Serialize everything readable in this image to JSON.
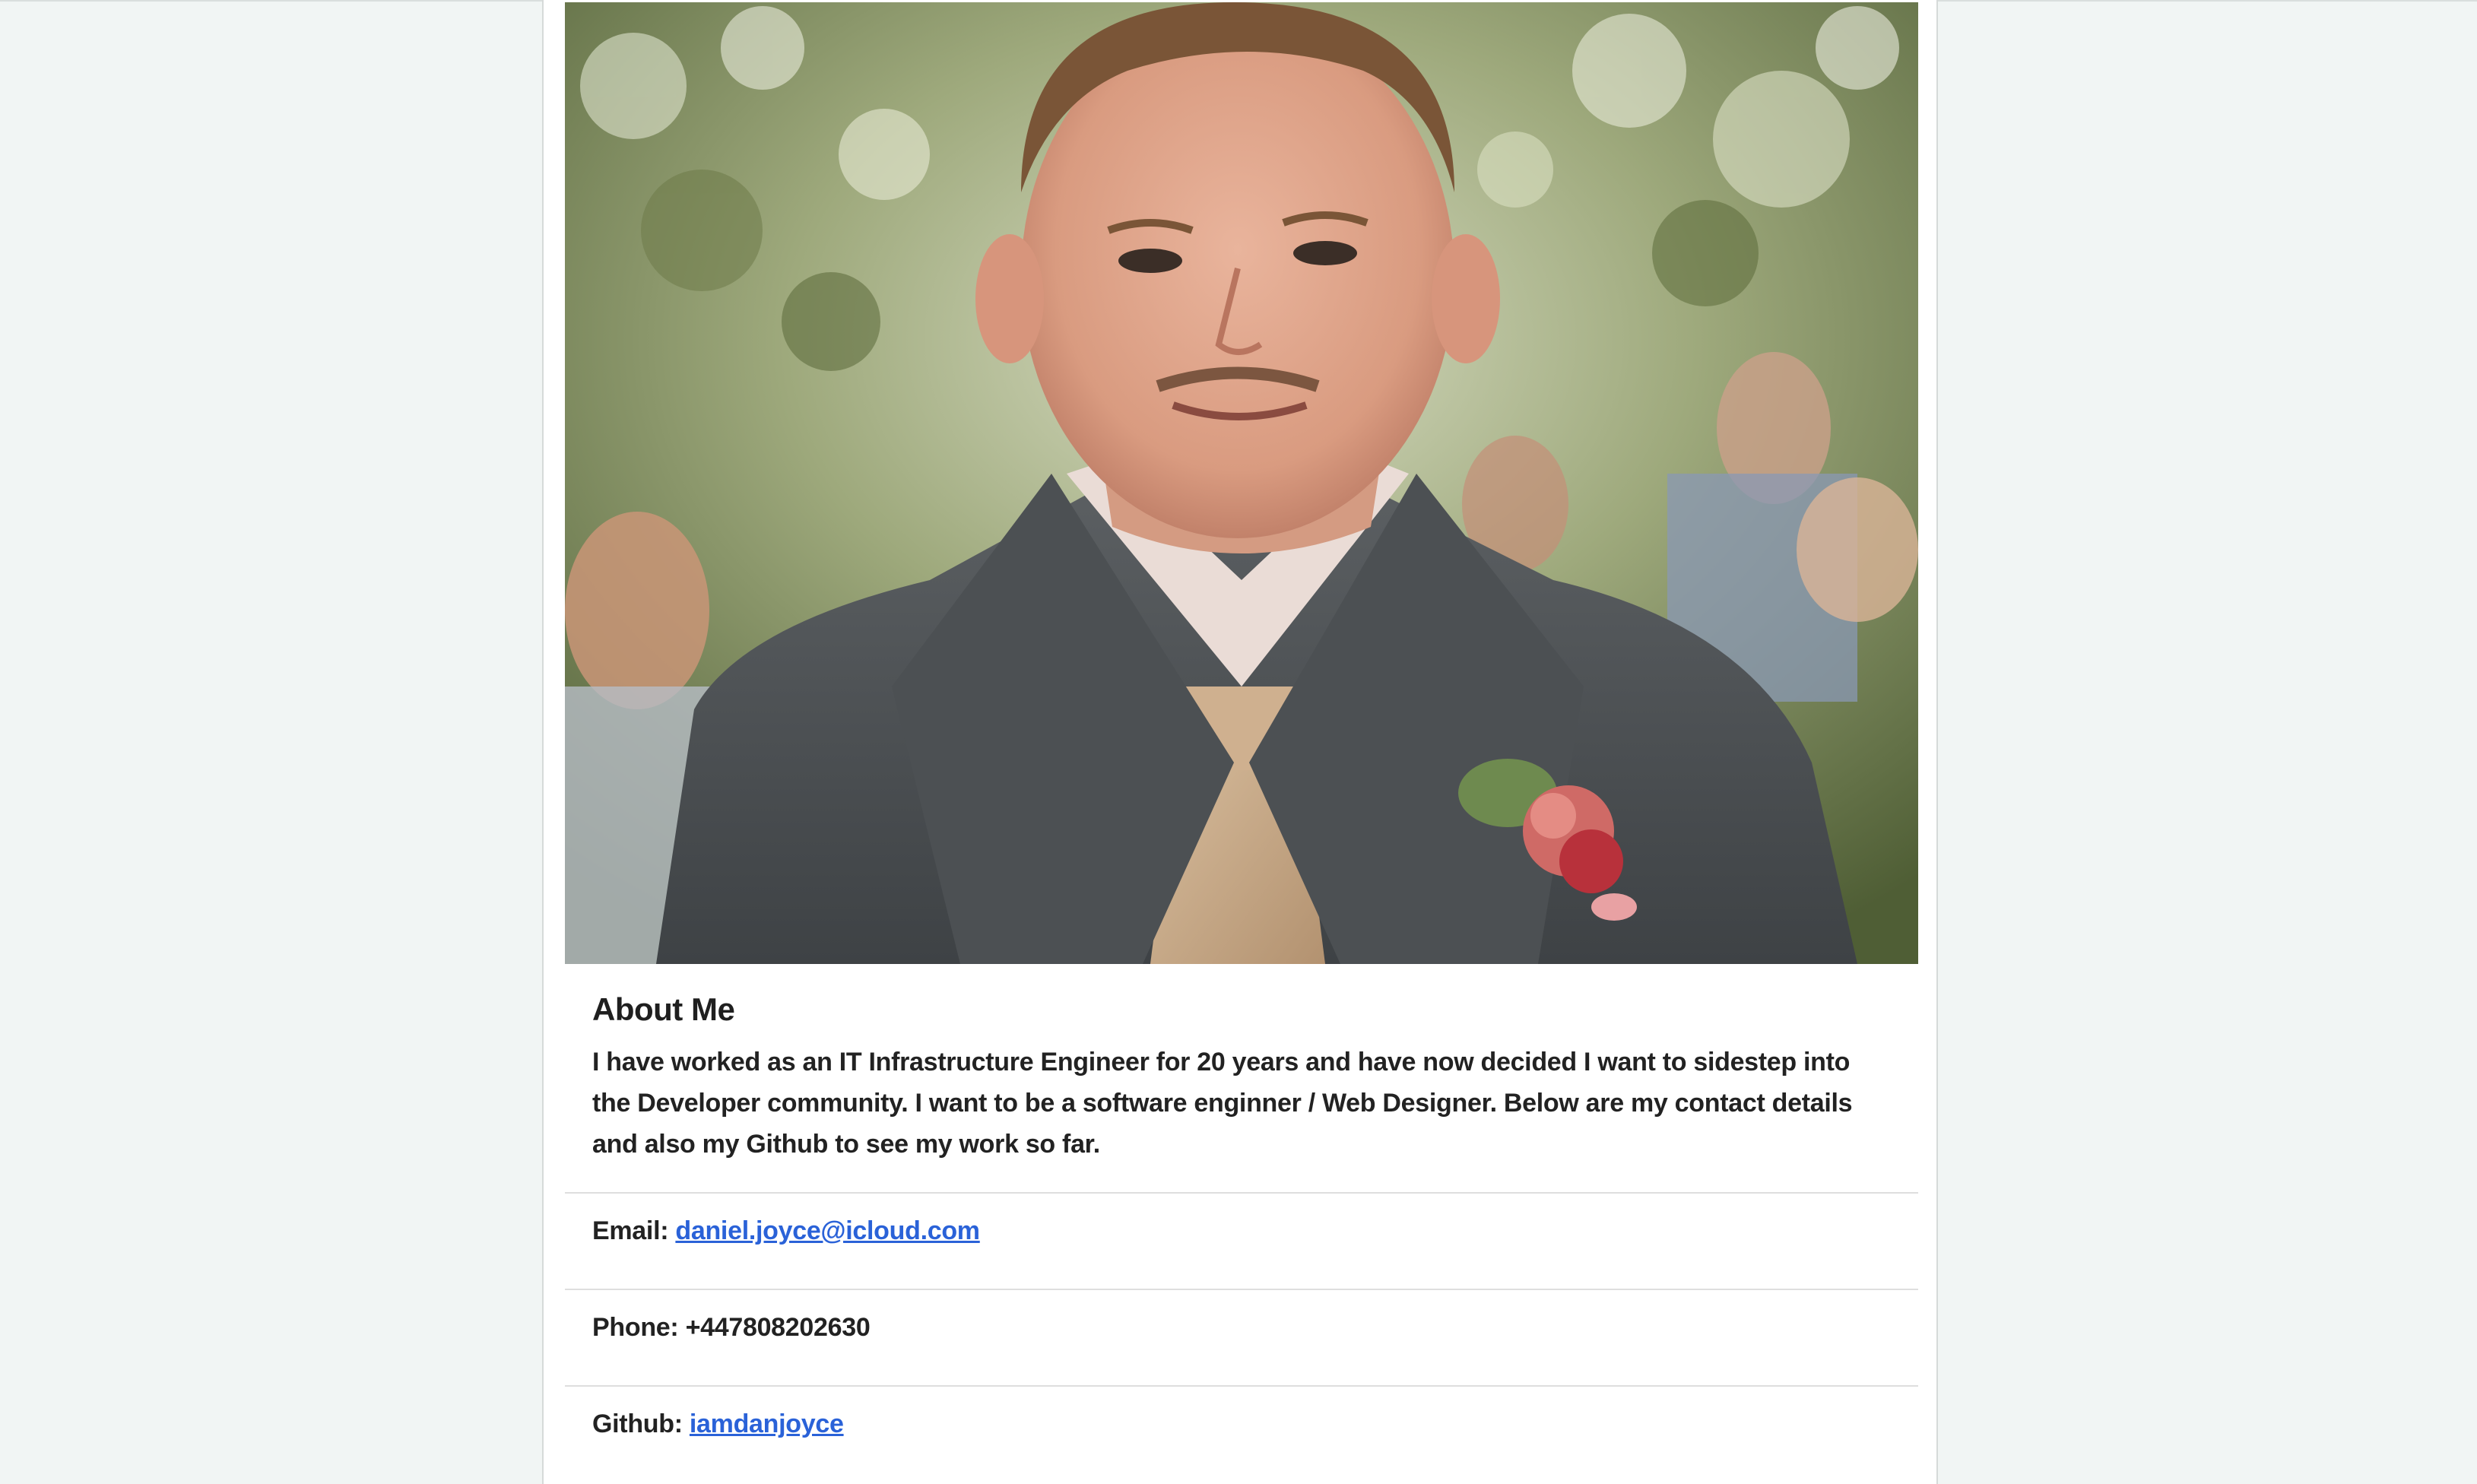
{
  "profile": {
    "photo_alt": "Portrait photo",
    "about_heading": "About Me",
    "about_text": "I have worked as an IT Infrastructure Engineer for 20 years and have now decided I want to sidestep into the Developer community. I want to be a software enginner / Web Designer. Below are my contact details and also my Github to see my work so far."
  },
  "contact": {
    "email_label": "Email:",
    "email_value": "daniel.joyce@icloud.com",
    "phone_label": "Phone:",
    "phone_value": "+447808202630",
    "github_label": "Github:",
    "github_value": "iamdanjoyce"
  },
  "colors": {
    "page_background": "#f1f5f4",
    "card_background": "#ffffff",
    "link": "#2a62d8"
  }
}
